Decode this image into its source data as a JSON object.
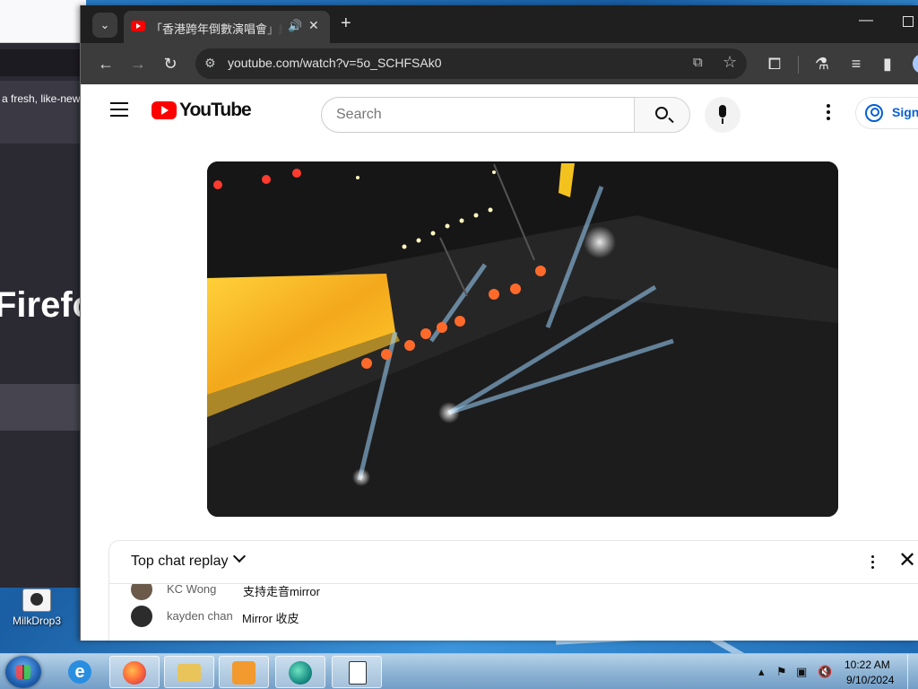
{
  "desktop": {
    "icon_label": "MilkDrop3"
  },
  "background_window": {
    "promo_text": "a fresh, like-new",
    "big_word": "Firefo"
  },
  "browser": {
    "tab": {
      "title": "「香港跨年倒數演唱會」線上",
      "favicon": "youtube-favicon",
      "audio_icon": "speaker-icon"
    },
    "new_tab_label": "+",
    "url": "youtube.com/watch?v=5o_SCHFSAk0",
    "accent": "#1f1f1f"
  },
  "youtube": {
    "logo_text": "YouTube",
    "search_placeholder": "Search",
    "signin_label": "Sign",
    "brand_color": "#ff0000",
    "link_color": "#065fd4"
  },
  "chat": {
    "title": "Top chat replay",
    "messages": [
      {
        "author": "KC Wong",
        "text": "支持走音mirror",
        "avatar_color": "#6b5a4a"
      },
      {
        "author": "kayden chan",
        "text": "Mirror 收皮",
        "avatar_color": "#2c2c2c"
      }
    ]
  },
  "taskbar": {
    "apps": [
      "internet-explorer",
      "firefox",
      "file-explorer",
      "media-player",
      "app-circle",
      "calculator-app"
    ],
    "clock_time": "10:22 AM",
    "clock_date": "9/10/2024"
  }
}
